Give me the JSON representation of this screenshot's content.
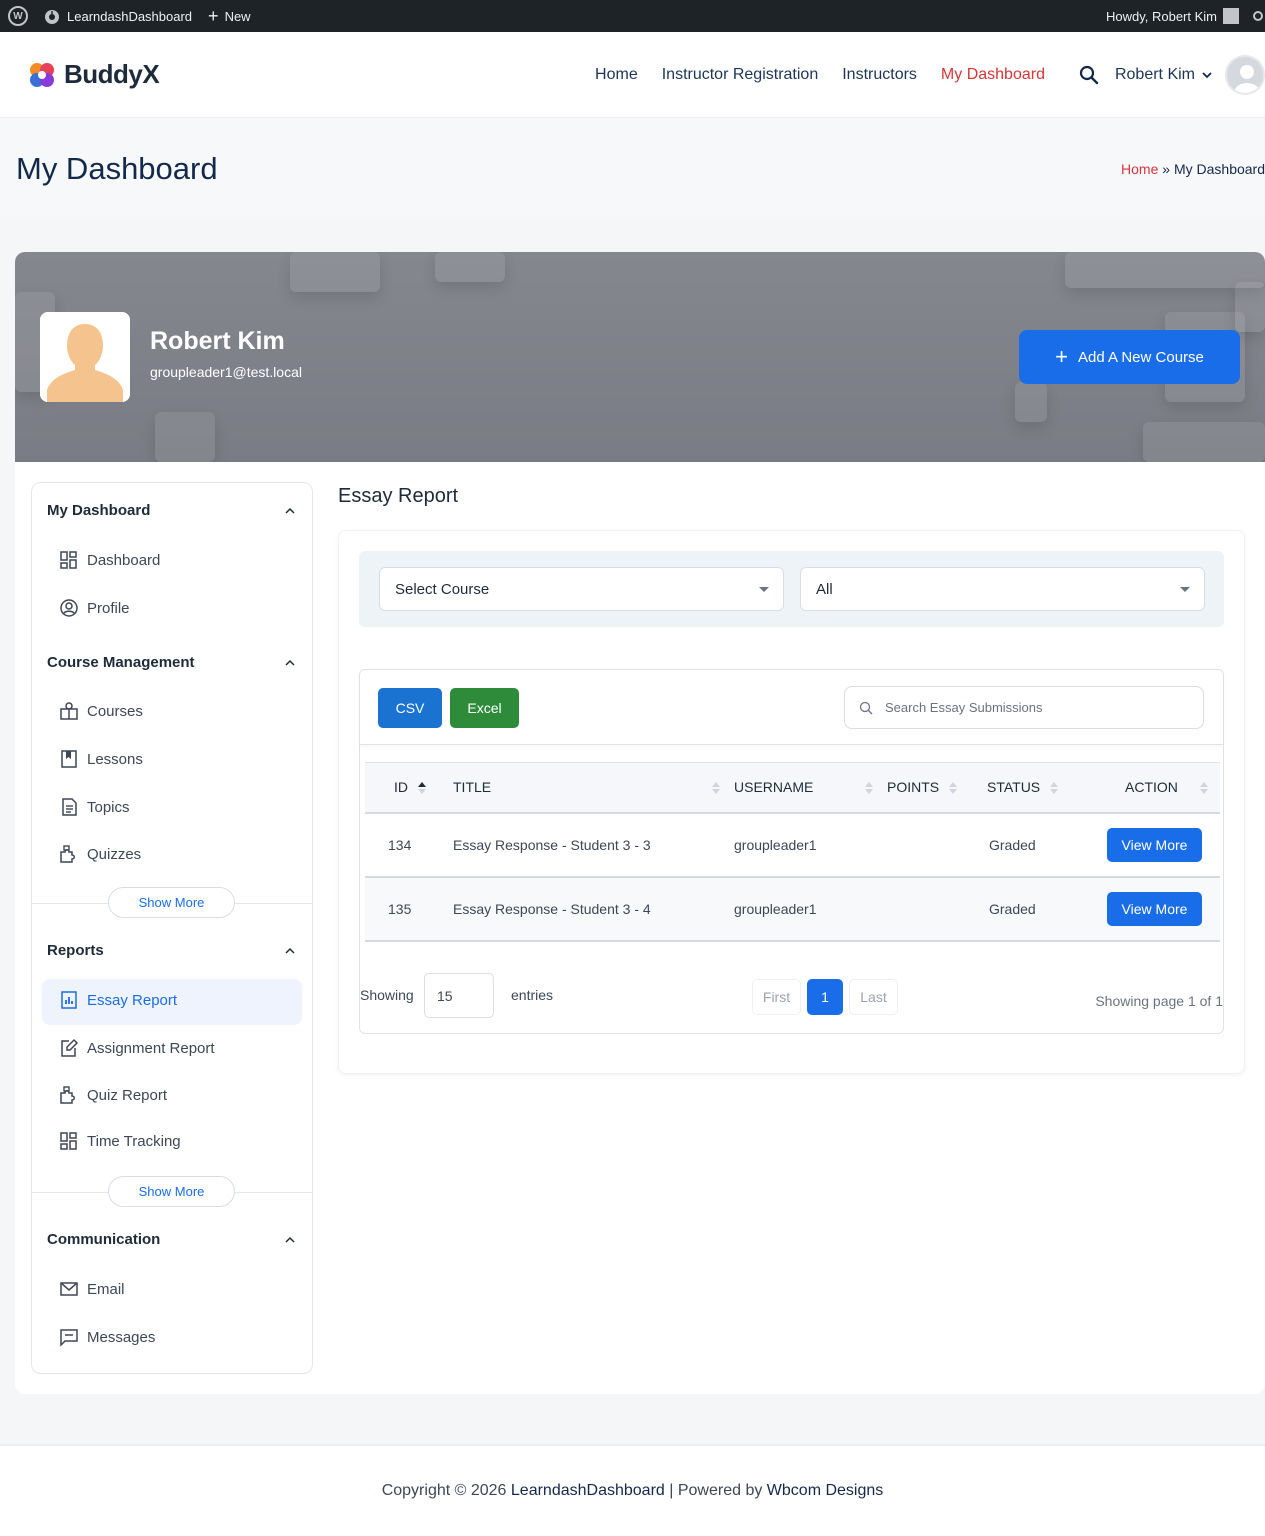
{
  "admin_bar": {
    "site_name": "LearndashDashboard",
    "new_label": "New",
    "howdy": "Howdy, Robert Kim"
  },
  "header": {
    "logo_text": "BuddyX",
    "nav": [
      "Home",
      "Instructor Registration",
      "Instructors",
      "My Dashboard"
    ],
    "active_nav": "My Dashboard",
    "user_name": "Robert Kim"
  },
  "page": {
    "title": "My Dashboard",
    "breadcrumb_home": "Home",
    "breadcrumb_sep": "»",
    "breadcrumb_current": "My Dashboard"
  },
  "profile": {
    "name": "Robert Kim",
    "email": "groupleader1@test.local",
    "add_course_label": "Add A New Course"
  },
  "sidebar": {
    "sections": [
      {
        "title": "My Dashboard",
        "items": [
          "Dashboard",
          "Profile"
        ]
      },
      {
        "title": "Course Management",
        "items": [
          "Courses",
          "Lessons",
          "Topics",
          "Quizzes"
        ],
        "show_more": "Show More"
      },
      {
        "title": "Reports",
        "items": [
          "Essay Report",
          "Assignment Report",
          "Quiz Report",
          "Time Tracking"
        ],
        "show_more": "Show More",
        "active_item": "Essay Report"
      },
      {
        "title": "Communication",
        "items": [
          "Email",
          "Messages"
        ]
      }
    ]
  },
  "content": {
    "title": "Essay Report",
    "course_select": "Select Course",
    "status_select": "All",
    "csv_label": "CSV",
    "excel_label": "Excel",
    "search_placeholder": "Search Essay Submissions",
    "columns": [
      "ID",
      "TITLE",
      "USERNAME",
      "POINTS",
      "STATUS",
      "ACTION"
    ],
    "rows": [
      {
        "id": "134",
        "title": "Essay Response - Student 3 - 3",
        "username": "groupleader1",
        "points": "",
        "status": "Graded",
        "action": "View More"
      },
      {
        "id": "135",
        "title": "Essay Response - Student 3 - 4",
        "username": "groupleader1",
        "points": "",
        "status": "Graded",
        "action": "View More"
      }
    ],
    "showing_label": "Showing",
    "page_length": "15",
    "entries_label": "entries",
    "pagination": {
      "first": "First",
      "current": "1",
      "last": "Last"
    },
    "page_info": "Showing page 1 of 1"
  },
  "footer": {
    "prefix": "Copyright © 2026",
    "site_link": "LearndashDashboard",
    "powered": "| Powered by",
    "company_link": "Wbcom Designs"
  },
  "colors": {
    "accent": "#1a6de8",
    "active_nav": "#d63638",
    "excel": "#2e8b3a",
    "admin_bar": "#1d2327"
  }
}
